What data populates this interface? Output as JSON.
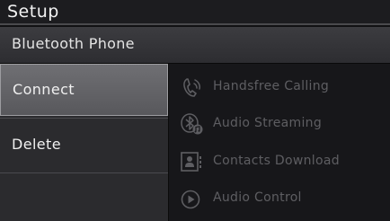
{
  "header": {
    "title": "Setup",
    "subtitle": "Bluetooth Phone"
  },
  "menu": {
    "items": [
      {
        "label": "Connect",
        "selected": true
      },
      {
        "label": "Delete",
        "selected": false
      }
    ]
  },
  "features": [
    {
      "label": "Handsfree Calling",
      "icon": "handsfree-phone-icon"
    },
    {
      "label": "Audio Streaming",
      "icon": "bluetooth-audio-icon"
    },
    {
      "label": "Contacts Download",
      "icon": "contacts-icon"
    },
    {
      "label": "Audio Control",
      "icon": "play-icon"
    }
  ],
  "colors": {
    "background": "#111113",
    "selected_item": "#626266",
    "disabled_text": "#5e5e62"
  }
}
